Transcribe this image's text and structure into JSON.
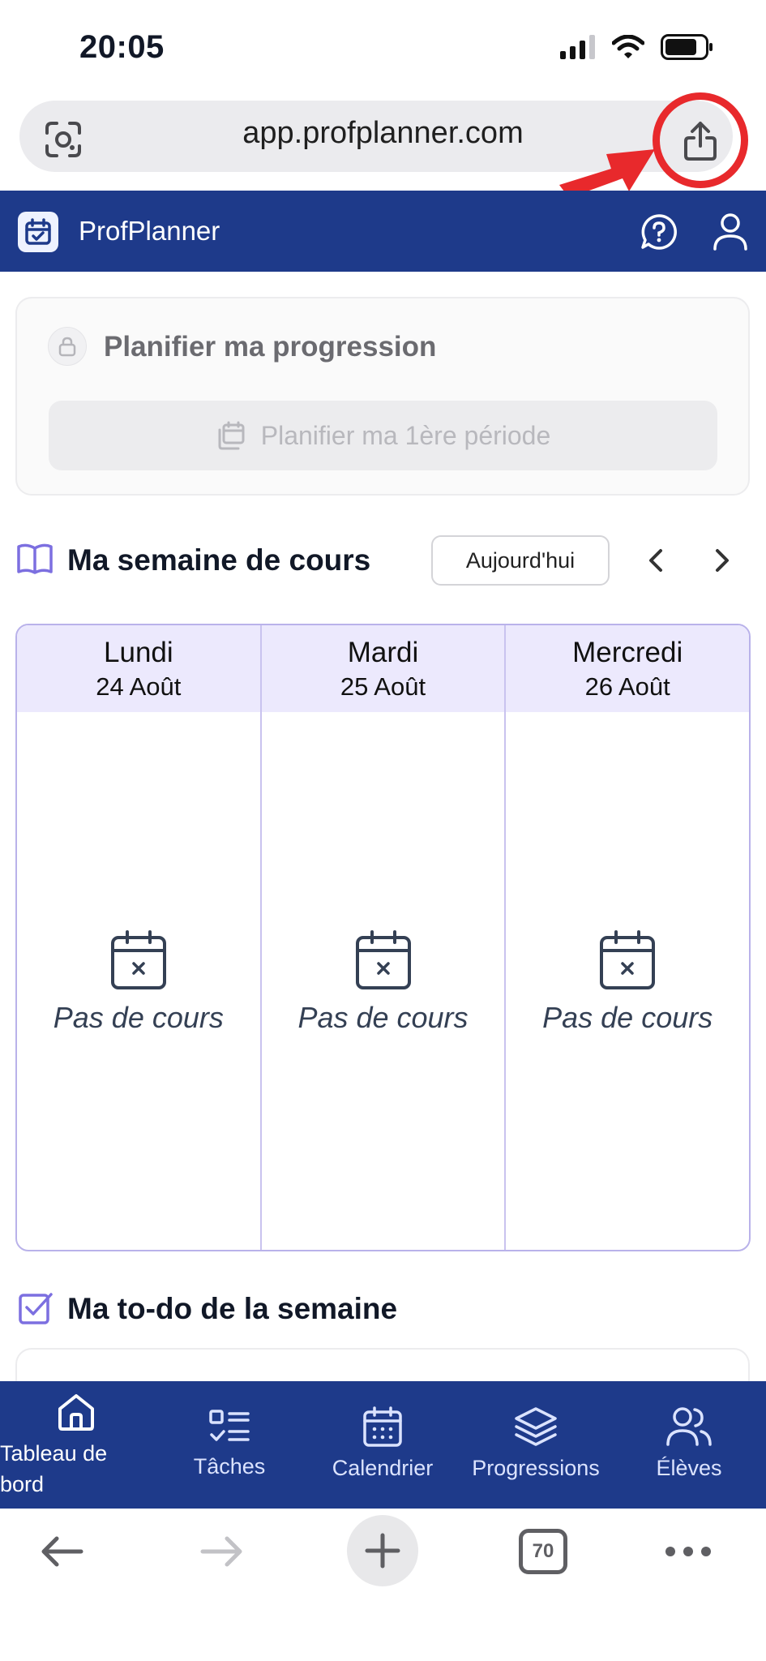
{
  "status_bar": {
    "time": "20:05"
  },
  "browser": {
    "url": "app.profplanner.com",
    "tab_count": "70"
  },
  "app": {
    "title": "ProfPlanner"
  },
  "plan_card": {
    "title": "Planifier ma progression",
    "button_label": "Planifier ma 1ère période"
  },
  "week": {
    "title": "Ma semaine de cours",
    "today_label": "Aujourd'hui",
    "days": [
      {
        "name": "Lundi",
        "date": "24 Août",
        "empty_text": "Pas de cours"
      },
      {
        "name": "Mardi",
        "date": "25 Août",
        "empty_text": "Pas de cours"
      },
      {
        "name": "Mercredi",
        "date": "26 Août",
        "empty_text": "Pas de cours"
      }
    ]
  },
  "todo": {
    "title": "Ma to-do de la semaine"
  },
  "bottom_nav": {
    "items": [
      {
        "label": "Tableau de bord",
        "icon": "home-icon",
        "active": true
      },
      {
        "label": "Tâches",
        "icon": "tasks-icon",
        "active": false
      },
      {
        "label": "Calendrier",
        "icon": "calendar-icon",
        "active": false
      },
      {
        "label": "Progressions",
        "icon": "layers-icon",
        "active": false
      },
      {
        "label": "Élèves",
        "icon": "users-icon",
        "active": false
      }
    ]
  },
  "colors": {
    "brand": "#1e3a8a",
    "accent_purple": "#7c6fe0",
    "day_header_bg": "#ece9fd",
    "annotation_red": "#e8292c"
  }
}
